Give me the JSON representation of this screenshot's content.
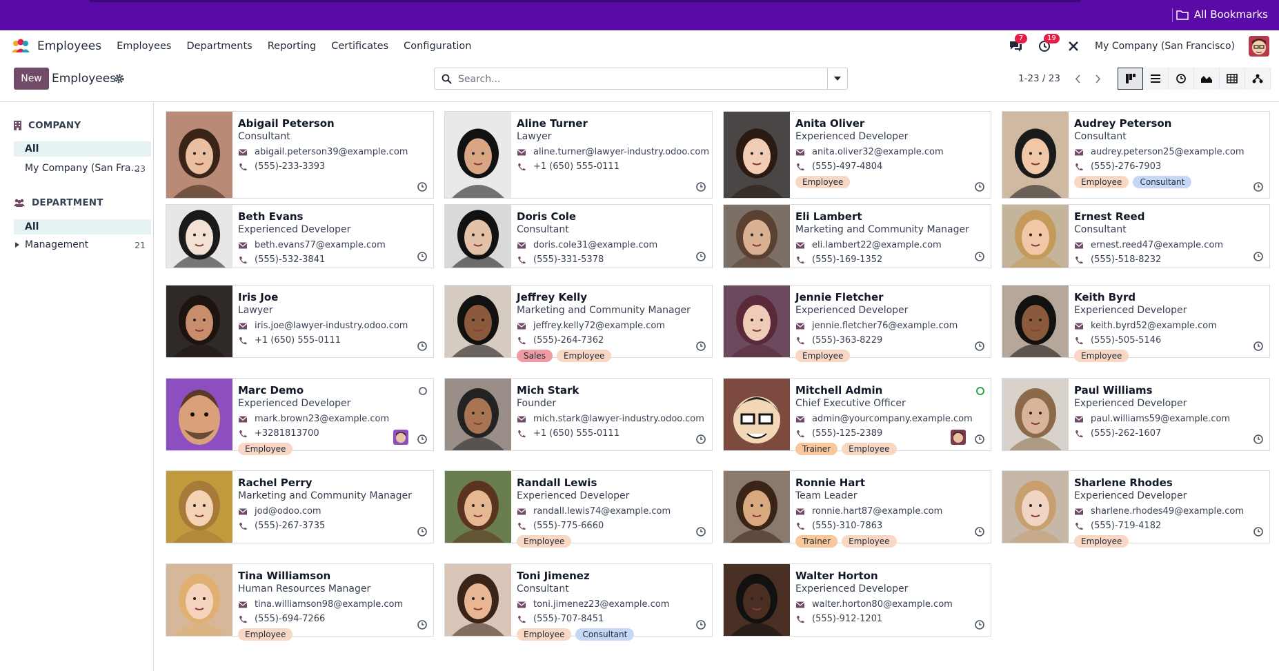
{
  "bookmarks": {
    "label": "All Bookmarks"
  },
  "navbar": {
    "app_name": "Employees",
    "menu": [
      "Employees",
      "Departments",
      "Reporting",
      "Certificates",
      "Configuration"
    ],
    "messages_count": "7",
    "activities_count": "19",
    "company": "My Company (San Francisco)"
  },
  "control_panel": {
    "new_label": "New",
    "title": "Employees",
    "search_placeholder": "Search...",
    "pager": "1-23 / 23"
  },
  "side_panel": {
    "company_header": "COMPANY",
    "company_items": [
      {
        "label": "All",
        "count": ""
      },
      {
        "label": "My Company (San Fra...",
        "count": "23"
      }
    ],
    "department_header": "DEPARTMENT",
    "department_items": [
      {
        "label": "All",
        "count": ""
      },
      {
        "label": "Management",
        "count": "21"
      }
    ]
  },
  "colors": {
    "bookmark_bar": "#5a0aa6",
    "brand": "#714b67",
    "tag_employee": "#f8d8c4",
    "tag_consultant": "#c4d7f5",
    "tag_sales": "#f09aa4",
    "tag_trainer": "#f9c79a"
  },
  "employees": [
    {
      "name": "Abigail Peterson",
      "job": "Consultant",
      "email": "abigail.peterson39@example.com",
      "phone": "(555)-233-3393",
      "tags": []
    },
    {
      "name": "Aline Turner",
      "job": "Lawyer",
      "email": "aline.turner@lawyer-industry.odoo.com",
      "phone": "+1 (650) 555-0111",
      "tags": []
    },
    {
      "name": "Anita Oliver",
      "job": "Experienced Developer",
      "email": "anita.oliver32@example.com",
      "phone": "(555)-497-4804",
      "tags": [
        "Employee"
      ]
    },
    {
      "name": "Audrey Peterson",
      "job": "Consultant",
      "email": "audrey.peterson25@example.com",
      "phone": "(555)-276-7903",
      "tags": [
        "Employee",
        "Consultant"
      ]
    },
    {
      "name": "Beth Evans",
      "job": "Experienced Developer",
      "email": "beth.evans77@example.com",
      "phone": "(555)-532-3841",
      "tags": []
    },
    {
      "name": "Doris Cole",
      "job": "Consultant",
      "email": "doris.cole31@example.com",
      "phone": "(555)-331-5378",
      "tags": []
    },
    {
      "name": "Eli Lambert",
      "job": "Marketing and Community Manager",
      "email": "eli.lambert22@example.com",
      "phone": "(555)-169-1352",
      "tags": []
    },
    {
      "name": "Ernest Reed",
      "job": "Consultant",
      "email": "ernest.reed47@example.com",
      "phone": "(555)-518-8232",
      "tags": []
    },
    {
      "name": "Iris Joe",
      "job": "Lawyer",
      "email": "iris.joe@lawyer-industry.odoo.com",
      "phone": "+1 (650) 555-0111",
      "tags": []
    },
    {
      "name": "Jeffrey Kelly",
      "job": "Marketing and Community Manager",
      "email": "jeffrey.kelly72@example.com",
      "phone": "(555)-264-7362",
      "tags": [
        "Sales",
        "Employee"
      ]
    },
    {
      "name": "Jennie Fletcher",
      "job": "Experienced Developer",
      "email": "jennie.fletcher76@example.com",
      "phone": "(555)-363-8229",
      "tags": [
        "Employee"
      ]
    },
    {
      "name": "Keith Byrd",
      "job": "Experienced Developer",
      "email": "keith.byrd52@example.com",
      "phone": "(555)-505-5146",
      "tags": [
        "Employee"
      ]
    },
    {
      "name": "Marc Demo",
      "job": "Experienced Developer",
      "email": "mark.brown23@example.com",
      "phone": "+3281813700",
      "tags": [
        "Employee"
      ],
      "presence": "offline",
      "user_avatar": true
    },
    {
      "name": "Mich Stark",
      "job": "Founder",
      "email": "mich.stark@lawyer-industry.odoo.com",
      "phone": "+1 (650) 555-0111",
      "tags": []
    },
    {
      "name": "Mitchell Admin",
      "job": "Chief Executive Officer",
      "email": "admin@yourcompany.example.com",
      "phone": "(555)-125-2389",
      "tags": [
        "Trainer",
        "Employee"
      ],
      "presence": "online",
      "user_avatar": true
    },
    {
      "name": "Paul Williams",
      "job": "Experienced Developer",
      "email": "paul.williams59@example.com",
      "phone": "(555)-262-1607",
      "tags": []
    },
    {
      "name": "Rachel Perry",
      "job": "Marketing and Community Manager",
      "email": "jod@odoo.com",
      "phone": "(555)-267-3735",
      "tags": []
    },
    {
      "name": "Randall Lewis",
      "job": "Experienced Developer",
      "email": "randall.lewis74@example.com",
      "phone": "(555)-775-6660",
      "tags": [
        "Employee"
      ]
    },
    {
      "name": "Ronnie Hart",
      "job": "Team Leader",
      "email": "ronnie.hart87@example.com",
      "phone": "(555)-310-7863",
      "tags": [
        "Trainer",
        "Employee"
      ]
    },
    {
      "name": "Sharlene Rhodes",
      "job": "Experienced Developer",
      "email": "sharlene.rhodes49@example.com",
      "phone": "(555)-719-4182",
      "tags": [
        "Employee"
      ]
    },
    {
      "name": "Tina Williamson",
      "job": "Human Resources Manager",
      "email": "tina.williamson98@example.com",
      "phone": "(555)-694-7266",
      "tags": [
        "Employee"
      ]
    },
    {
      "name": "Toni Jimenez",
      "job": "Consultant",
      "email": "toni.jimenez23@example.com",
      "phone": "(555)-707-8451",
      "tags": [
        "Employee",
        "Consultant"
      ]
    },
    {
      "name": "Walter Horton",
      "job": "Experienced Developer",
      "email": "walter.horton80@example.com",
      "phone": "(555)-912-1201",
      "tags": []
    }
  ]
}
